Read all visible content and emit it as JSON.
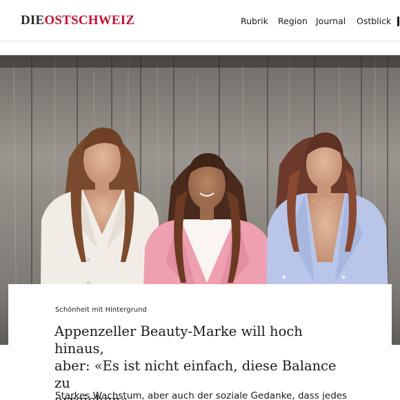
{
  "header": {
    "logo_prefix": "DIE",
    "logo_name": "OSTSCHWEIZ",
    "nav": [
      "Rubrik",
      "Region",
      "Journal",
      "Ostblick"
    ]
  },
  "article": {
    "kicker": "Schönheit mit Hintergrund",
    "headline_line1": "Appenzeller Beauty-Marke will hoch hinaus,",
    "headline_line2": "aber: «Es ist nicht einfach, diese Balance zu",
    "headline_line3": "erreichen»",
    "lead": "Starkes Wachstum, aber auch der soziale Gedanke, dass jedes"
  },
  "colors": {
    "brand_red": "#c8102e",
    "wood": "#8a8681"
  }
}
